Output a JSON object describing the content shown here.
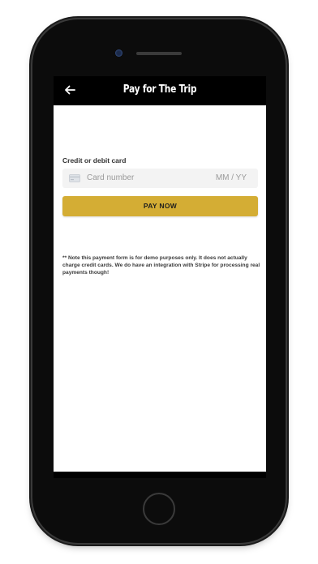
{
  "nav": {
    "title": "Pay for The Trip",
    "back_icon": "arrow-left-icon"
  },
  "payment": {
    "card_label": "Credit or debit card",
    "card_number_placeholder": "Card number",
    "expiry_placeholder": "MM / YY",
    "card_icon": "credit-card-icon",
    "pay_button_label": "PAY NOW"
  },
  "note": "** Note this payment form is for demo purposes only. It does not actually charge credit cards. We do have an integration with Stripe for processing real payments though!",
  "colors": {
    "accent": "#d4ad34",
    "nav_background": "#000000",
    "input_background": "#f3f3f3"
  }
}
